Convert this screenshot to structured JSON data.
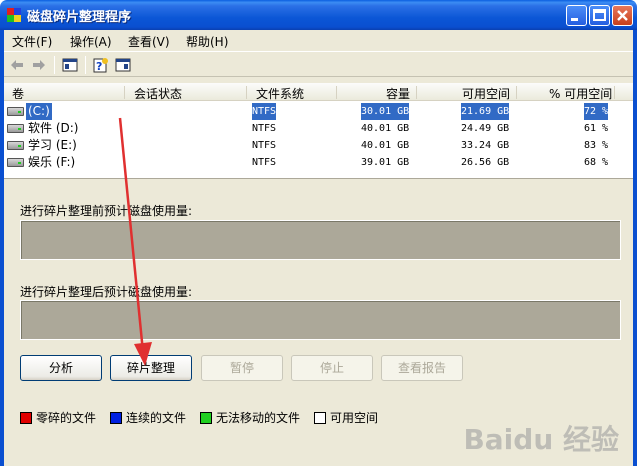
{
  "window": {
    "title": "磁盘碎片整理程序"
  },
  "menu": {
    "items": [
      {
        "label": "文件(F)"
      },
      {
        "label": "操作(A)"
      },
      {
        "label": "查看(V)"
      },
      {
        "label": "帮助(H)"
      }
    ]
  },
  "toolbar": {
    "icons": [
      "back-arrow-icon",
      "forward-arrow-icon",
      "properties-icon",
      "help-icon",
      "view-icon"
    ]
  },
  "volumes": {
    "columns": [
      "卷",
      "会话状态",
      "文件系统",
      "容量",
      "可用空间",
      "% 可用空间"
    ],
    "rows": [
      {
        "name": "(C:)",
        "status": "",
        "fs": "NTFS",
        "capacity": "30.01 GB",
        "free": "21.69 GB",
        "pct": "72 %",
        "selected": true
      },
      {
        "name": "软件 (D:)",
        "status": "",
        "fs": "NTFS",
        "capacity": "40.01 GB",
        "free": "24.49 GB",
        "pct": "61 %",
        "selected": false
      },
      {
        "name": "学习 (E:)",
        "status": "",
        "fs": "NTFS",
        "capacity": "40.01 GB",
        "free": "33.24 GB",
        "pct": "83 %",
        "selected": false
      },
      {
        "name": "娱乐 (F:)",
        "status": "",
        "fs": "NTFS",
        "capacity": "39.01 GB",
        "free": "26.56 GB",
        "pct": "68 %",
        "selected": false
      }
    ]
  },
  "estimates": {
    "before_label": "进行碎片整理前预计磁盘使用量:",
    "after_label": "进行碎片整理后预计磁盘使用量:"
  },
  "buttons": {
    "analyze": "分析",
    "defragment": "碎片整理",
    "pause": "暂停",
    "stop": "停止",
    "view_report": "查看报告"
  },
  "legend": [
    {
      "label": "零碎的文件",
      "color": "#e00000"
    },
    {
      "label": "连续的文件",
      "color": "#0020e0"
    },
    {
      "label": "无法移动的文件",
      "color": "#20d020"
    },
    {
      "label": "可用空间",
      "color": "#ffffff"
    }
  ],
  "watermark": "Baidu 经验"
}
